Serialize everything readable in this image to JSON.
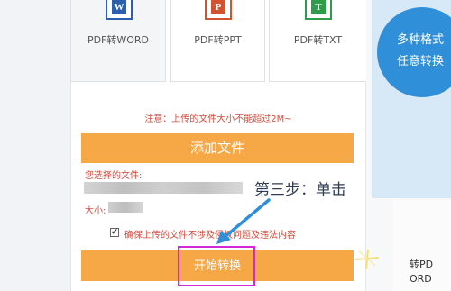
{
  "cards": [
    {
      "label": "PDF转WORD",
      "icon": "W",
      "color": "#2b5fad",
      "bg": "#f4f5f7"
    },
    {
      "label": "PDF转PPT",
      "icon": "P",
      "color": "#d35230",
      "bg": "#ffffff"
    },
    {
      "label": "PDF转TXT",
      "icon": "T",
      "color": "#2e9d4a",
      "bg": "#ffffff"
    }
  ],
  "promo": {
    "line1": "多种格式",
    "line2": "任意转换"
  },
  "upload": {
    "notice": "注意：上传的文件大小不能超过2M~",
    "add_button": "添加文件",
    "chosen_label": "您选择的文件:",
    "size_label": "大小:",
    "agree_text": "确保上传的文件不涉及侵权问题及违法内容",
    "agree_checked": "✔",
    "start_button": "开始转换"
  },
  "annotation": {
    "step_text": "第三步：单击"
  },
  "right_partial": {
    "line1": "转PD",
    "line2": "ORD"
  },
  "colors": {
    "accent": "#f7a846",
    "warning": "#d24c3c",
    "promo_blue": "#2f8fd8",
    "highlight": "#d02ad6",
    "arrow": "#2f8fd8"
  }
}
